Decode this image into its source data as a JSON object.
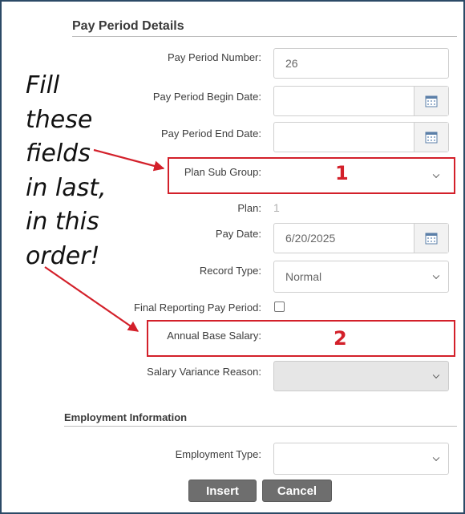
{
  "pay_period": {
    "section_title": "Pay Period Details",
    "number_label": "Pay Period Number:",
    "number_value": "26",
    "begin_date_label": "Pay Period Begin Date:",
    "begin_date_value": "",
    "end_date_label": "Pay Period End Date:",
    "end_date_value": "",
    "plan_sub_group_label": "Plan Sub Group:",
    "plan_sub_group_value": "",
    "plan_label": "Plan:",
    "plan_value": "1",
    "pay_date_label": "Pay Date:",
    "pay_date_value": "6/20/2025",
    "record_type_label": "Record Type:",
    "record_type_value": "Normal",
    "final_reporting_label": "Final Reporting Pay Period:",
    "final_reporting_checked": false,
    "annual_base_salary_label": "Annual Base Salary:",
    "annual_base_salary_value": "",
    "salary_variance_label": "Salary Variance Reason:",
    "salary_variance_value": ""
  },
  "employment": {
    "section_title": "Employment Information",
    "type_label": "Employment Type:",
    "type_value": ""
  },
  "buttons": {
    "insert": "Insert",
    "cancel": "Cancel"
  },
  "annotation": {
    "lines": [
      "Fill",
      "these",
      "fields",
      "in last,",
      "in this",
      "order!"
    ],
    "marker_1": "1",
    "marker_2": "2",
    "color": "#d3202a"
  }
}
